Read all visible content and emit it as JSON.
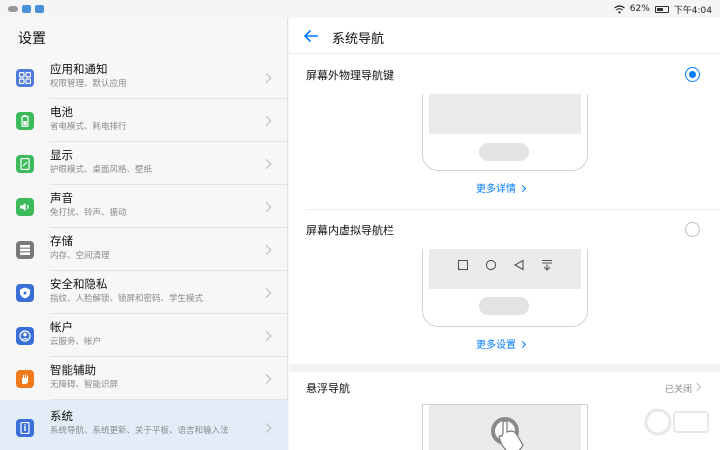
{
  "statusbar": {
    "battery": "62%",
    "time": "下午4:04",
    "battery_level": 0.62
  },
  "left": {
    "title": "设置",
    "items": [
      {
        "title": "应用和通知",
        "sub": "权限管理、默认应用",
        "icon": "apps-icon",
        "color": "#4f7bd9"
      },
      {
        "title": "电池",
        "sub": "省电模式、耗电排行",
        "icon": "battery-icon",
        "color": "#3dbb5c"
      },
      {
        "title": "显示",
        "sub": "护眼模式、桌面风格、壁纸",
        "icon": "display-icon",
        "color": "#3dbb5c"
      },
      {
        "title": "声音",
        "sub": "免打扰、铃声、振动",
        "icon": "sound-icon",
        "color": "#3dbb5c"
      },
      {
        "title": "存储",
        "sub": "内存、空间清理",
        "icon": "storage-icon",
        "color": "#7a7a7a"
      },
      {
        "title": "安全和隐私",
        "sub": "指纹、人脸解锁、锁屏和密码、学生模式",
        "icon": "shield-icon",
        "color": "#3a6fd8"
      },
      {
        "title": "帐户",
        "sub": "云服务、帐户",
        "icon": "account-icon",
        "color": "#3a6fd8"
      },
      {
        "title": "智能辅助",
        "sub": "无障碍、智能识屏",
        "icon": "hand-icon",
        "color": "#f07a1c"
      },
      {
        "title": "系统",
        "sub": "系统导航、系统更新、关于平板、语言和输入法",
        "icon": "system-icon",
        "color": "#3a6fd8",
        "selected": true
      }
    ]
  },
  "right": {
    "title": "系统导航",
    "option1": {
      "label": "屏幕外物理导航键",
      "selected": true,
      "link": "更多详情"
    },
    "option2": {
      "label": "屏幕内虚拟导航栏",
      "selected": false,
      "link": "更多设置"
    },
    "float": {
      "label": "悬浮导航",
      "status": "已关闭"
    }
  }
}
